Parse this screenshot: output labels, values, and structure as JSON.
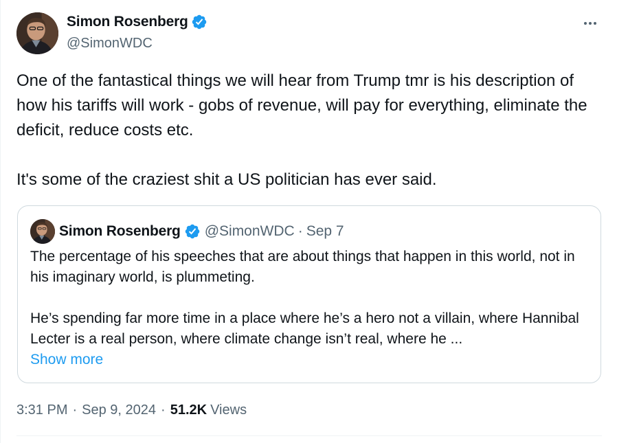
{
  "author": {
    "display_name": "Simon Rosenberg",
    "handle": "@SimonWDC",
    "verified": true
  },
  "more_icon": "more-horizontal-icon",
  "tweet": {
    "paragraphs": [
      "One of the fantastical things we will hear from Trump tmr is his description of how his tariffs will work - gobs of revenue, will pay for everything, eliminate the deficit, reduce costs etc.",
      "It's some of the craziest shit a US politician has ever said."
    ]
  },
  "quoted": {
    "display_name": "Simon Rosenberg",
    "handle": "@SimonWDC",
    "separator": "·",
    "date": "Sep 7",
    "paragraphs": [
      "The percentage of his speeches that are about things that happen in this world, not in his imaginary world, is plummeting.",
      "He’s spending far more time in a place where he’s a hero not a villain, where Hannibal Lecter is a real person, where climate change isn’t real, where he ..."
    ],
    "show_more": "Show more"
  },
  "meta": {
    "time": "3:31 PM",
    "separator": "·",
    "date": "Sep 9, 2024",
    "views_count": "51.2K",
    "views_label": "Views"
  },
  "colors": {
    "text": "#0f1419",
    "secondary": "#536471",
    "accent": "#1d9bf0",
    "border": "#cfd9de"
  }
}
